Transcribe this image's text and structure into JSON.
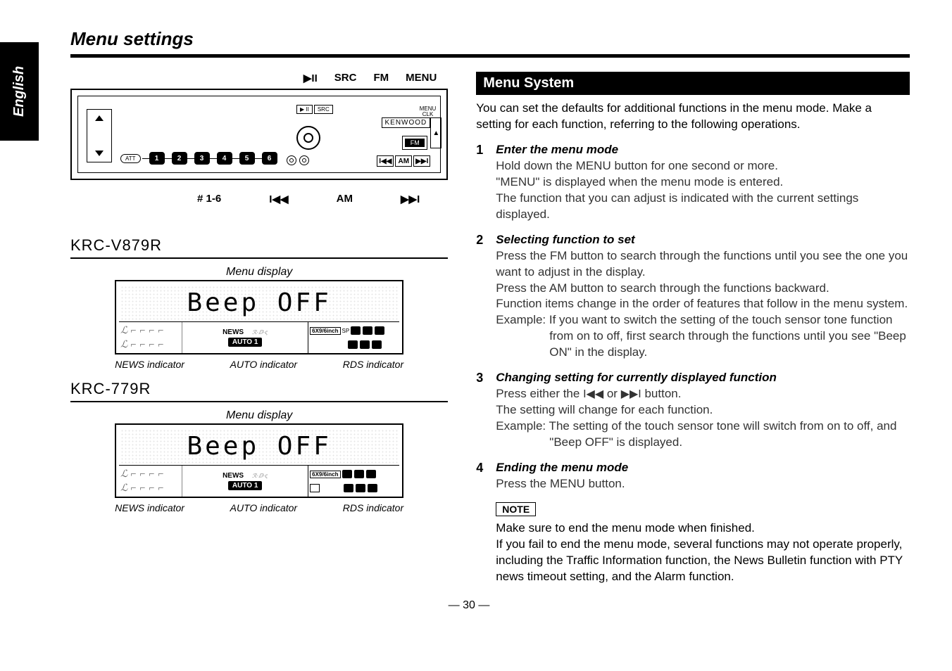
{
  "sidebar_label": "English",
  "title": "Menu settings",
  "device": {
    "callouts_top": {
      "play": "▶II",
      "src": "SRC",
      "fm": "FM",
      "menu": "MENU"
    },
    "brand": "KENWOOD",
    "fm_badge": "FM",
    "eject": "▲",
    "att": "ATT",
    "presets": [
      "1",
      "2",
      "3",
      "4",
      "5",
      "6"
    ],
    "seek": {
      "prev": "I◀◀",
      "am": "AM",
      "next": "▶▶I"
    },
    "menu_clk": "MENU\nCLK",
    "src_btn": "SRC",
    "callouts_bottom": {
      "presets": "# 1-6",
      "prev": "I◀◀",
      "am": "AM",
      "next": "▶▶I"
    }
  },
  "display1": {
    "model": "KRC-V879R",
    "caption": "Menu display",
    "main_text": "Beep OFF",
    "news": "NEWS",
    "rds_logo": "ℛ·ⅅ·ς",
    "auto": "AUTO 1",
    "spk": "6X9/6inch",
    "sp": "SP",
    "sublabels": {
      "news": "NEWS indicator",
      "auto": "AUTO indicator",
      "rds": "RDS indicator"
    }
  },
  "display2": {
    "model": "KRC-779R",
    "caption": "Menu display",
    "main_text": "Beep OFF",
    "news": "NEWS",
    "rds_logo": "ℛ·ⅅ·ς",
    "auto": "AUTO 1",
    "spk": "6X9/6inch",
    "sublabels": {
      "news": "NEWS indicator",
      "auto": "AUTO indicator",
      "rds": "RDS indicator"
    }
  },
  "right": {
    "header": "Menu System",
    "intro": "You can set the defaults for additional functions in the menu mode. Make a setting for each function, referring to the following operations.",
    "steps": [
      {
        "num": "1",
        "title": "Enter the menu mode",
        "body": "Hold down the MENU button for one second or more.\n\"MENU\" is displayed when the menu mode is entered.\nThe function that you can adjust is indicated with the current settings displayed."
      },
      {
        "num": "2",
        "title": "Selecting function to set",
        "body": "Press the FM button to search through the functions until you see the one you want to adjust in the display.\nPress the AM button to search through the functions backward.\nFunction items change in the order of features that follow in the menu system.",
        "example": "Example: If you want to switch the setting of the touch sensor tone function from on to off, first search through the functions until you see \"Beep ON\" in the display."
      },
      {
        "num": "3",
        "title": "Changing setting for currently displayed function",
        "body_pre": "Press either the ",
        "body_mid": " or ",
        "body_post": " button.\nThe setting will change for each function.",
        "example": "Example: The setting of the touch sensor tone will switch from on to off, and \"Beep OFF\" is displayed."
      },
      {
        "num": "4",
        "title": "Ending the menu mode",
        "body": "Press the MENU button."
      }
    ],
    "note_label": "NOTE",
    "note_body": "Make sure to end the menu mode when finished.\nIf you fail to end the menu mode, several functions may not operate properly, including the Traffic Information function, the News Bulletin function with PTY news timeout setting, and the Alarm function."
  },
  "pagenum": "— 30 —"
}
